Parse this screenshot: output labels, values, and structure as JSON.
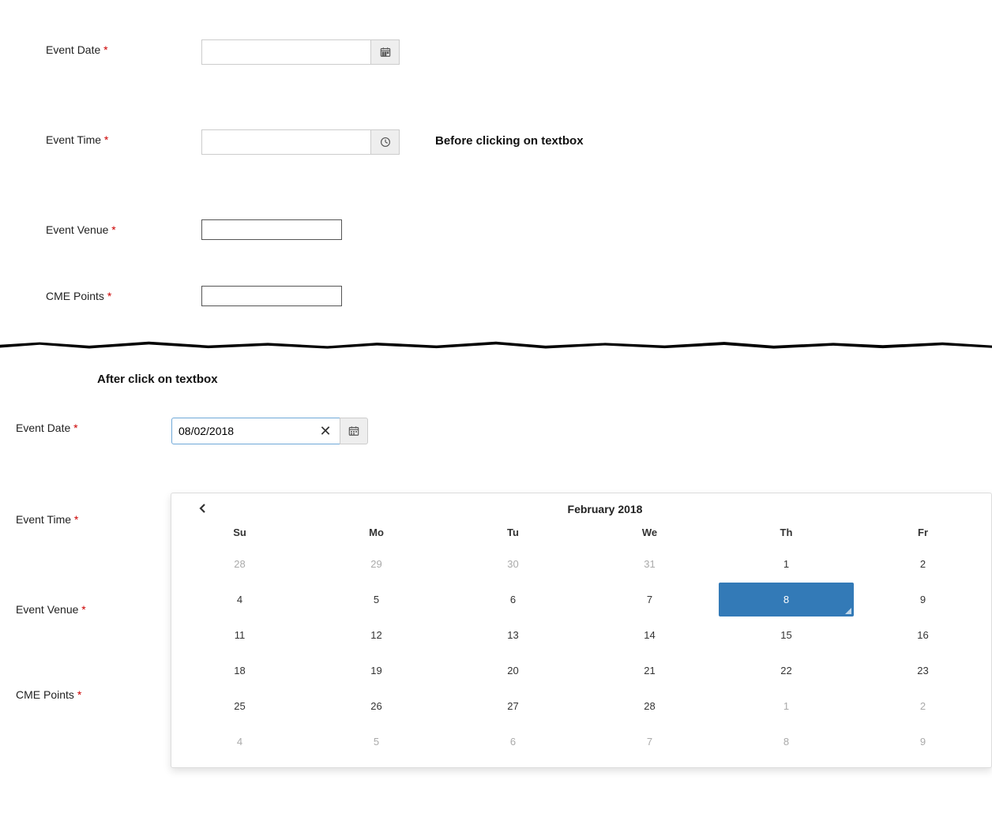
{
  "top": {
    "fields": {
      "event_date": {
        "label": "Event Date",
        "value": ""
      },
      "event_time": {
        "label": "Event Time",
        "value": ""
      },
      "event_venue": {
        "label": "Event Venue",
        "value": ""
      },
      "cme_points": {
        "label": "CME Points",
        "value": ""
      }
    },
    "annotation": "Before clicking on textbox",
    "required_marker": "*"
  },
  "bottom": {
    "annotation": "After click on textbox",
    "fields": {
      "event_date": {
        "label": "Event Date",
        "value": "08/02/2018"
      },
      "event_time": {
        "label": "Event Time",
        "value": ""
      },
      "event_venue": {
        "label": "Event Venue",
        "value": ""
      },
      "cme_points": {
        "label": "CME Points",
        "value": ""
      }
    },
    "required_marker": "*"
  },
  "datepicker": {
    "title": "February 2018",
    "dow": [
      "Su",
      "Mo",
      "Tu",
      "We",
      "Th",
      "Fr"
    ],
    "selected": "8",
    "selected_color": "#337ab7",
    "weeks": [
      [
        {
          "d": "28",
          "muted": true
        },
        {
          "d": "29",
          "muted": true
        },
        {
          "d": "30",
          "muted": true
        },
        {
          "d": "31",
          "muted": true
        },
        {
          "d": "1"
        },
        {
          "d": "2"
        }
      ],
      [
        {
          "d": "4"
        },
        {
          "d": "5"
        },
        {
          "d": "6"
        },
        {
          "d": "7"
        },
        {
          "d": "8",
          "selected": true
        },
        {
          "d": "9"
        }
      ],
      [
        {
          "d": "11"
        },
        {
          "d": "12"
        },
        {
          "d": "13"
        },
        {
          "d": "14"
        },
        {
          "d": "15"
        },
        {
          "d": "16"
        }
      ],
      [
        {
          "d": "18"
        },
        {
          "d": "19"
        },
        {
          "d": "20"
        },
        {
          "d": "21"
        },
        {
          "d": "22"
        },
        {
          "d": "23"
        }
      ],
      [
        {
          "d": "25"
        },
        {
          "d": "26"
        },
        {
          "d": "27"
        },
        {
          "d": "28"
        },
        {
          "d": "1",
          "muted": true
        },
        {
          "d": "2",
          "muted": true
        }
      ],
      [
        {
          "d": "4",
          "muted": true
        },
        {
          "d": "5",
          "muted": true
        },
        {
          "d": "6",
          "muted": true
        },
        {
          "d": "7",
          "muted": true
        },
        {
          "d": "8",
          "muted": true
        },
        {
          "d": "9",
          "muted": true
        }
      ]
    ]
  }
}
